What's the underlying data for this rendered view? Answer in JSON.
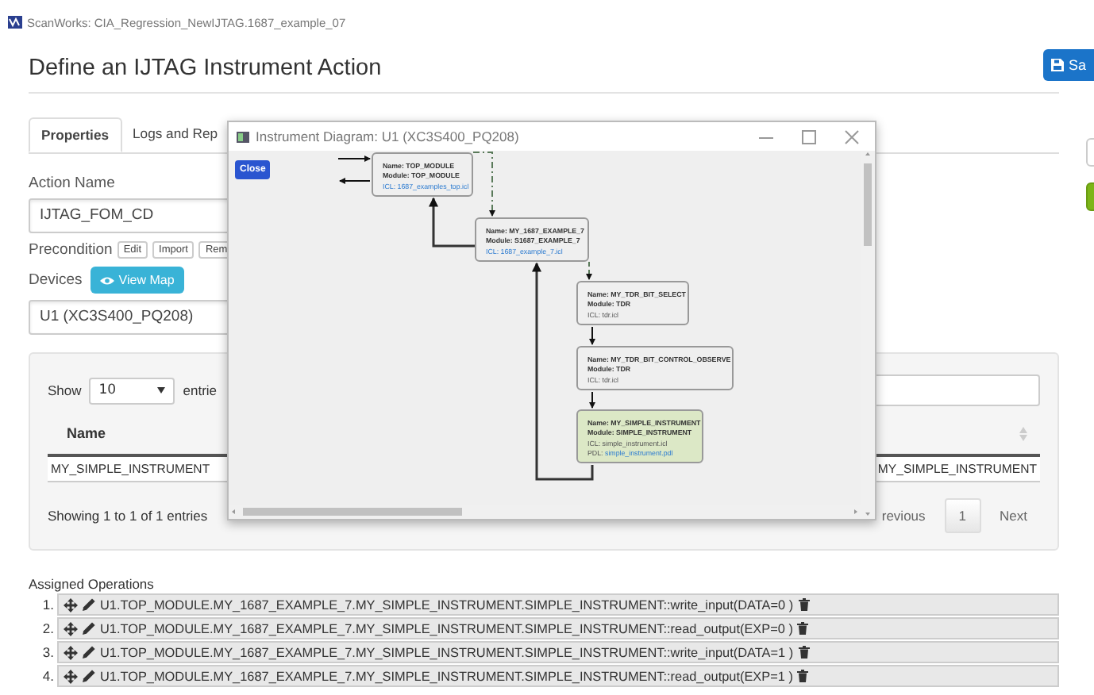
{
  "window": {
    "title": "ScanWorks: CIA_Regression_NewIJTAG.1687_example_07"
  },
  "heading": "Define an IJTAG Instrument Action",
  "save_button": "Sa",
  "tabs": [
    {
      "label": "Properties",
      "selected": true
    },
    {
      "label": "Logs and Rep",
      "selected": false
    }
  ],
  "side_buttons": [
    {
      "kind": "default"
    },
    {
      "kind": "success"
    }
  ],
  "action_name": {
    "label": "Action Name",
    "value": "IJTAG_FOM_CD"
  },
  "precondition": {
    "label": "Precondition",
    "buttons": [
      "Edit",
      "Import",
      "Rem"
    ]
  },
  "devices": {
    "label": "Devices",
    "view_map": "View Map",
    "value": "U1 (XC3S400_PQ208)"
  },
  "table_panel": {
    "show_label": "Show",
    "page_size": "10",
    "entries_label": "entrie",
    "columns": [
      "Name"
    ],
    "rows": [
      {
        "cells": [
          "MY_SIMPLE_INSTRUMENT",
          "MY_SIMPLE_INSTRUMENT"
        ]
      }
    ],
    "info": "Showing 1 to 1 of 1 entries",
    "pagination": [
      {
        "label": "revious",
        "selected": false
      },
      {
        "label": "1",
        "selected": true
      },
      {
        "label": "Next",
        "selected": false
      }
    ]
  },
  "assigned_operations": {
    "title": "Assigned Operations",
    "items": [
      {
        "number": "1.",
        "text": "U1.TOP_MODULE.MY_1687_EXAMPLE_7.MY_SIMPLE_INSTRUMENT.SIMPLE_INSTRUMENT::write_input(DATA=0 )"
      },
      {
        "number": "2.",
        "text": "U1.TOP_MODULE.MY_1687_EXAMPLE_7.MY_SIMPLE_INSTRUMENT.SIMPLE_INSTRUMENT::read_output(EXP=0 )"
      },
      {
        "number": "3.",
        "text": "U1.TOP_MODULE.MY_1687_EXAMPLE_7.MY_SIMPLE_INSTRUMENT.SIMPLE_INSTRUMENT::write_input(DATA=1 )"
      },
      {
        "number": "4.",
        "text": "U1.TOP_MODULE.MY_1687_EXAMPLE_7.MY_SIMPLE_INSTRUMENT.SIMPLE_INSTRUMENT::read_output(EXP=1 )"
      }
    ]
  },
  "dialog": {
    "title": "Instrument Diagram: U1 (XC3S400_PQ208)",
    "close_button": "Close",
    "nodes": [
      {
        "highlighted": false,
        "lines": [
          {
            "kind": "bold",
            "text": "Name: TOP_MODULE"
          },
          {
            "kind": "bold",
            "text": "Module: TOP_MODULE"
          },
          {
            "kind": "link",
            "text": "ICL: 1687_examples_top.icl"
          }
        ]
      },
      {
        "highlighted": false,
        "lines": [
          {
            "kind": "bold",
            "text": "Name: MY_1687_EXAMPLE_7"
          },
          {
            "kind": "bold",
            "text": "Module: S1687_EXAMPLE_7"
          },
          {
            "kind": "link",
            "text": "ICL: 1687_example_7.icl"
          }
        ]
      },
      {
        "highlighted": false,
        "lines": [
          {
            "kind": "bold",
            "text": "Name: MY_TDR_BIT_SELECT"
          },
          {
            "kind": "bold",
            "text": "Module: TDR"
          },
          {
            "kind": "plain",
            "text": "ICL: tdr.icl"
          }
        ]
      },
      {
        "highlighted": false,
        "lines": [
          {
            "kind": "bold",
            "text": "Name: MY_TDR_BIT_CONTROL_OBSERVE"
          },
          {
            "kind": "bold",
            "text": "Module: TDR"
          },
          {
            "kind": "plain",
            "text": "ICL: tdr.icl"
          }
        ]
      },
      {
        "highlighted": true,
        "lines": [
          {
            "kind": "bold",
            "text": "Name: MY_SIMPLE_INSTRUMENT"
          },
          {
            "kind": "bold",
            "text": "Module: SIMPLE_INSTRUMENT"
          },
          {
            "kind": "plain",
            "text": "ICL: simple_instrument.icl"
          },
          {
            "kind": "pdl",
            "label": "PDL:",
            "text": "simple_instrument.pdl"
          }
        ]
      }
    ]
  }
}
